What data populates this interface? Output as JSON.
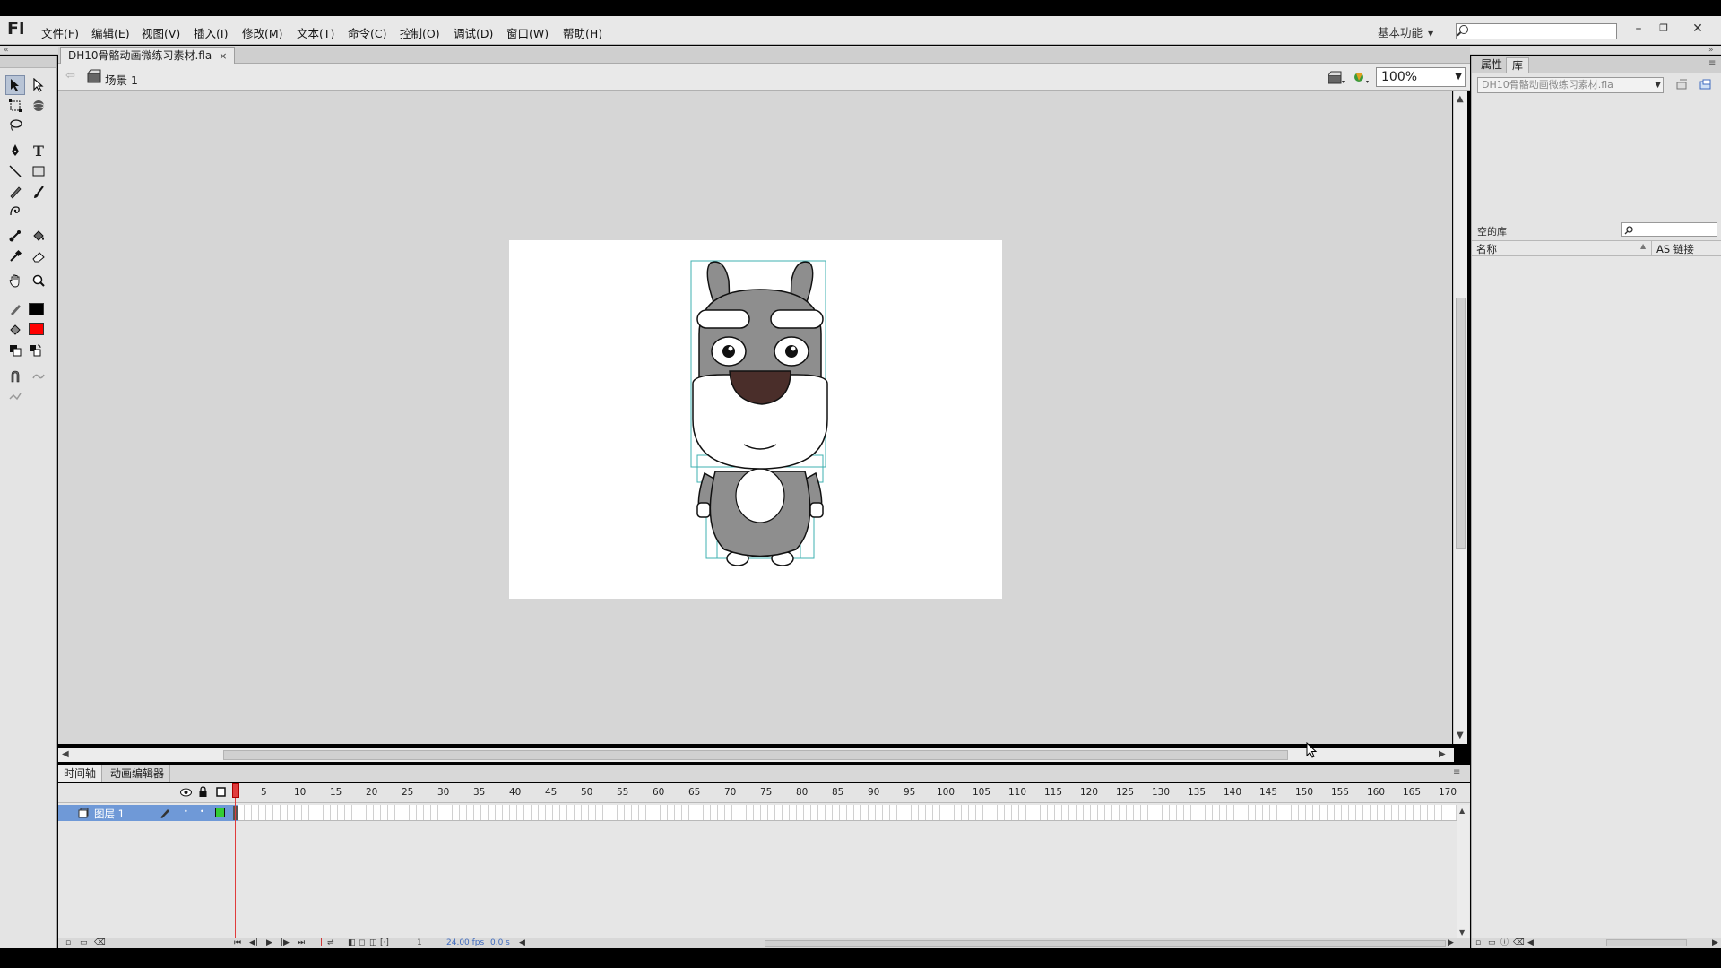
{
  "app": {
    "logo": "Fl"
  },
  "menu": {
    "items": [
      "文件(F)",
      "编辑(E)",
      "视图(V)",
      "插入(I)",
      "修改(M)",
      "文本(T)",
      "命令(C)",
      "控制(O)",
      "调试(D)",
      "窗口(W)",
      "帮助(H)"
    ]
  },
  "workspace": {
    "label": "基本功能"
  },
  "window_controls": {
    "minimize": "–",
    "restore": "❐",
    "close": "✕"
  },
  "document": {
    "tab_title": "DH10骨骼动画微练习素材.fla",
    "close": "×"
  },
  "editbar": {
    "scene": "场景 1",
    "zoom": "100%"
  },
  "timeline": {
    "tabs": [
      "时间轴",
      "动画编辑器"
    ],
    "frame_numbers": [
      "5",
      "10",
      "15",
      "20",
      "25",
      "30",
      "35",
      "40",
      "45",
      "50",
      "55",
      "60",
      "65",
      "70",
      "75",
      "80",
      "85",
      "90",
      "95",
      "100",
      "105",
      "110",
      "115",
      "120",
      "125",
      "130",
      "135",
      "140",
      "145",
      "150",
      "155",
      "160",
      "165",
      "170"
    ],
    "layer_name": "图层 1",
    "current_frame": "1",
    "fps": "24.00 fps",
    "time": "0.0 s"
  },
  "right_panel": {
    "tabs": [
      "属性",
      "库"
    ],
    "library_select": "DH10骨骼动画微练习素材.fla",
    "library_status": "空的库",
    "column_name": "名称",
    "column_linkage": "AS 链接"
  },
  "icons": {
    "tools": [
      "selection-tool-icon",
      "subselection-tool-icon",
      "free-transform-tool-icon",
      "3d-rotation-tool-icon",
      "lasso-tool-icon",
      "pen-tool-icon",
      "text-tool-icon",
      "line-tool-icon",
      "rectangle-tool-icon",
      "pencil-tool-icon",
      "brush-tool-icon",
      "deco-tool-icon",
      "bone-tool-icon",
      "paint-bucket-tool-icon",
      "eyedropper-tool-icon",
      "eraser-tool-icon",
      "hand-tool-icon",
      "zoom-tool-icon"
    ]
  },
  "colors": {
    "stroke_color": "#000000",
    "fill_color": "#ff0000",
    "layer_highlight": "#6f99d7",
    "playhead": "#e03c3c",
    "stage": "#ffffff",
    "pasteboard": "#d6d6d6"
  }
}
